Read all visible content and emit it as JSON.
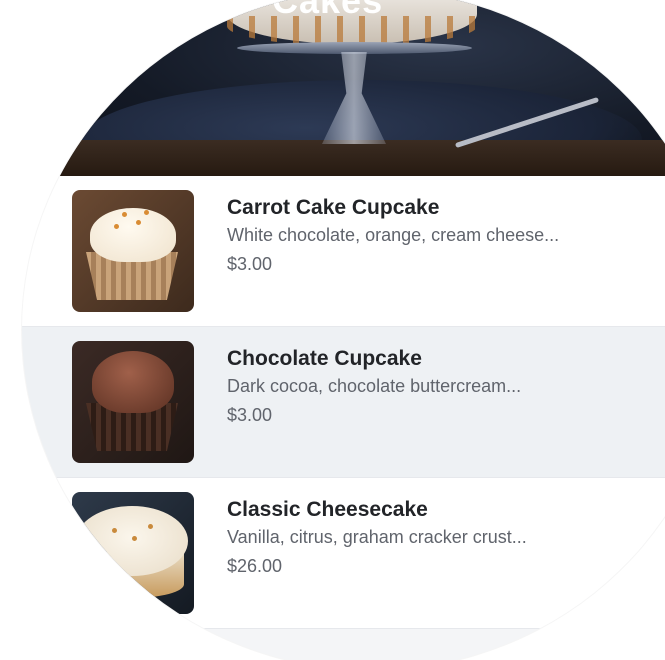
{
  "hero": {
    "title": "Cakes"
  },
  "menu": {
    "items": [
      {
        "name": "Carrot Cake Cupcake",
        "description": "White chocolate, orange, cream cheese...",
        "price": "$3.00",
        "image": "carrot-cupcake-image"
      },
      {
        "name": "Chocolate Cupcake",
        "description": "Dark cocoa, chocolate buttercream...",
        "price": "$3.00",
        "image": "chocolate-cupcake-image"
      },
      {
        "name": "Classic Cheesecake",
        "description": "Vanilla, citrus, graham cracker crust...",
        "price": "$26.00",
        "image": "cheesecake-image"
      }
    ]
  },
  "colors": {
    "row_highlight": "#eef1f4",
    "title_text": "#222428",
    "secondary_text": "#60646c"
  }
}
